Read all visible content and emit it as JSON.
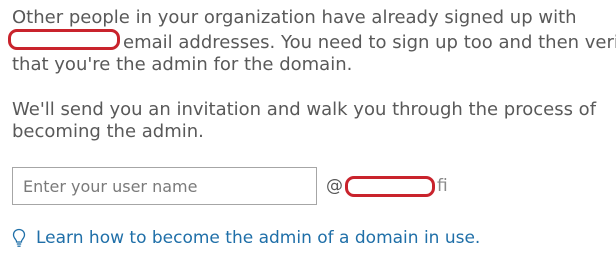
{
  "message": {
    "line1": "Other people in your organization have already signed up with",
    "line2_rest": "email addresses. You need to sign up too and then verify",
    "line3": "that you're the admin for the domain."
  },
  "invitation": {
    "line1": "We'll send you an invitation and walk you through the process of",
    "line2": "becoming the admin."
  },
  "form": {
    "username_placeholder": "Enter your user name",
    "username_value": "",
    "at_sign": "@",
    "domain_suffix": "fi"
  },
  "help": {
    "icon": "lightbulb-icon",
    "link_text": "Learn how to become the admin of a domain in use."
  },
  "colors": {
    "text": "#595959",
    "link": "#1f6fa8",
    "redaction": "#c9232c",
    "input_border": "#a6a6a6"
  }
}
